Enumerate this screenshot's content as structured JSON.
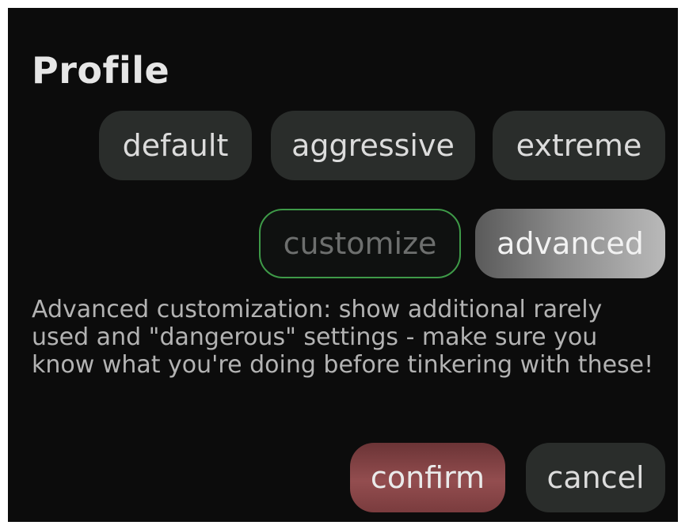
{
  "dialog": {
    "title": "Profile",
    "profiles": {
      "default_label": "default",
      "aggressive_label": "aggressive",
      "extreme_label": "extreme"
    },
    "modes": {
      "customize_label": "customize",
      "advanced_label": "advanced"
    },
    "description": "Advanced customization: show additional rarely used and \"dangerous\" settings - make sure you know what you're doing before tinkering with these!",
    "actions": {
      "confirm_label": "confirm",
      "cancel_label": "cancel"
    }
  },
  "colors": {
    "background": "#0c0c0c",
    "pill": "#2a2d2b",
    "customize_border": "#3e9a48",
    "confirm": "#934d4f",
    "advanced_selected": "#8a8a8a"
  }
}
